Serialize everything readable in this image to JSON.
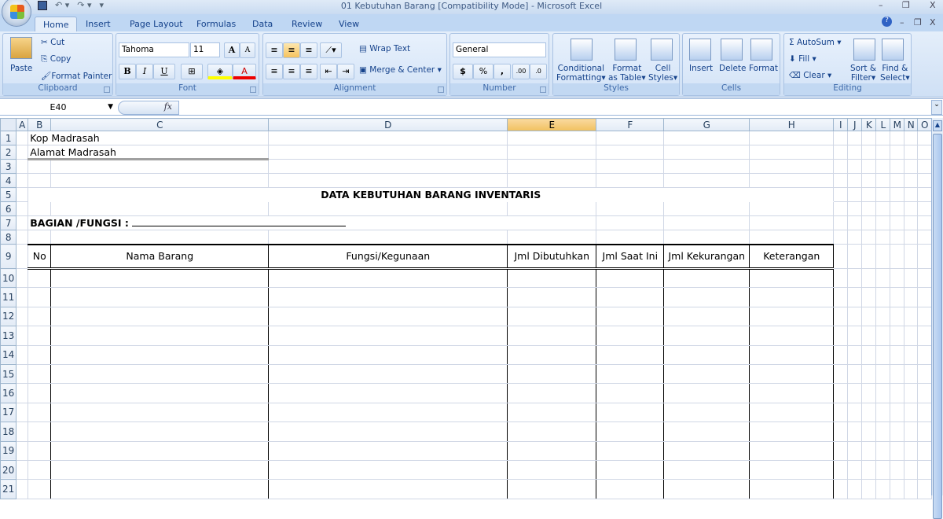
{
  "window": {
    "title": "01 Kebutuhan Barang  [Compatibility Mode] - Microsoft Excel",
    "minimize": "–",
    "restore": "❐",
    "close": "X"
  },
  "qat": {
    "save_icon": "save-icon",
    "undo": "↶ ▾",
    "redo": "↷ ▾",
    "customize": "▾"
  },
  "tabs": [
    "Home",
    "Insert",
    "Page Layout",
    "Formulas",
    "Data",
    "Review",
    "View"
  ],
  "ribbon": {
    "clipboard": {
      "label": "Clipboard",
      "paste": "Paste",
      "cut": "Cut",
      "copy": "Copy",
      "format_painter": "Format Painter"
    },
    "font": {
      "label": "Font",
      "name": "Tahoma",
      "size": "11",
      "bold": "B",
      "italic": "I",
      "underline": "U",
      "grow": "A",
      "shrink": "A",
      "font_color": "A"
    },
    "alignment": {
      "label": "Alignment",
      "wrap": "Wrap Text",
      "merge": "Merge & Center"
    },
    "number": {
      "label": "Number",
      "format": "General",
      "currency": "$",
      "percent": "%",
      "comma": ",",
      "inc_dec": ".00",
      "dec_dec": ".0"
    },
    "styles": {
      "label": "Styles",
      "conditional": [
        "Conditional",
        "Formatting"
      ],
      "table": [
        "Format",
        "as Table"
      ],
      "cell": [
        "Cell",
        "Styles"
      ]
    },
    "cells": {
      "label": "Cells",
      "insert": "Insert",
      "delete": "Delete",
      "format": "Format"
    },
    "editing": {
      "label": "Editing",
      "autosum": "AutoSum",
      "fill": "Fill",
      "clear": "Clear",
      "sort": [
        "Sort &",
        "Filter"
      ],
      "find": [
        "Find &",
        "Select"
      ]
    }
  },
  "formula_bar": {
    "name_box": "E40",
    "fx": "fx",
    "value": ""
  },
  "sheet": {
    "columns": [
      "A",
      "B",
      "C",
      "D",
      "E",
      "F",
      "G",
      "H",
      "I",
      "J",
      "K",
      "L",
      "M",
      "N",
      "O"
    ],
    "selected_column": "E",
    "rows": [
      1,
      2,
      3,
      4,
      5,
      6,
      7,
      8,
      9,
      10,
      11,
      12,
      13,
      14,
      15,
      16,
      17,
      18,
      19,
      20,
      21
    ],
    "kop": "Kop Madrasah",
    "alamat": "Alamat Madrasah",
    "title": "DATA KEBUTUHAN BARANG INVENTARIS",
    "bagian": "BAGIAN /FUNGSI : ",
    "headers": [
      "No",
      "Nama Barang",
      "Fungsi/Kegunaan",
      "Jml Dibutuhkan",
      "Jml Saat Ini",
      "Jml Kekurangan",
      "Keterangan"
    ]
  }
}
